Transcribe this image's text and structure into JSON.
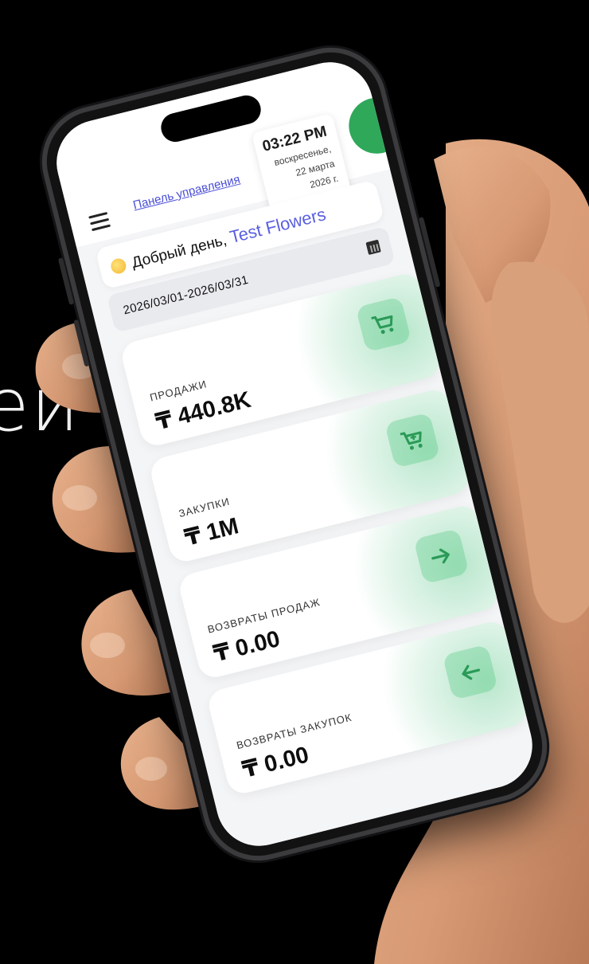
{
  "background": {
    "partial_text": "ей"
  },
  "header": {
    "dashboard_link": "Панель управления",
    "clock": {
      "time": "03:22 PM",
      "weekday": "воскресенье,",
      "date": "22 марта",
      "year": "2026 г."
    }
  },
  "greeting": {
    "text": "Добрый день, ",
    "name": "Test Flowers",
    "emoji": "sun-face-icon"
  },
  "date_range": {
    "value": "2026/03/01-2026/03/31",
    "icon": "calendar-icon"
  },
  "stats": [
    {
      "label": "ПРОДАЖИ",
      "value": "₸ 440.8K",
      "icon": "cart-icon"
    },
    {
      "label": "ЗАКУПКИ",
      "value": "₸ 1M",
      "icon": "cart-plus-icon"
    },
    {
      "label": "ВОЗВРАТЫ ПРОДАЖ",
      "value": "₸ 0.00",
      "icon": "arrow-right-icon"
    },
    {
      "label": "ВОЗВРАТЫ ЗАКУПОК",
      "value": "₸ 0.00",
      "icon": "arrow-left-icon"
    }
  ],
  "colors": {
    "accent_green": "#2fa85a",
    "accent_blue": "#4a4fd6",
    "icon_green": "#2a9a57"
  }
}
